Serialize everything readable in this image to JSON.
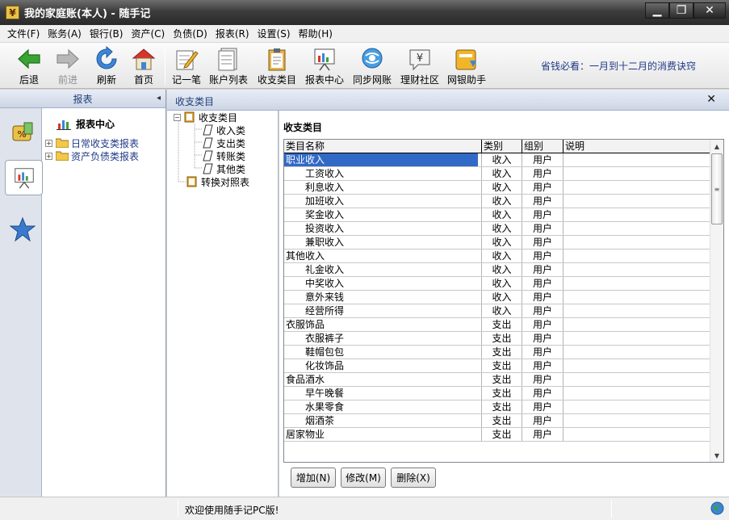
{
  "window": {
    "title": "我的家庭账(本人) - 随手记",
    "app_icon_glyph": "¥",
    "minimize": "▁",
    "maximize": "❐",
    "close": "✕"
  },
  "menu": [
    "文件(F)",
    "账务(A)",
    "银行(B)",
    "资产(C)",
    "负债(D)",
    "报表(R)",
    "设置(S)",
    "帮助(H)"
  ],
  "toolbar": {
    "back": "后退",
    "forward": "前进",
    "refresh": "刷新",
    "home": "首页",
    "record": "记一笔",
    "accounts": "账户列表",
    "categories": "收支类目",
    "reports": "报表中心",
    "sync": "同步网账",
    "community": "理财社区",
    "ebank": "网银助手",
    "tip": "省钱必看：一月到十二月的消费诀窍"
  },
  "left_panel": {
    "header": "报表",
    "collapse": "◂",
    "tree_title": "报表中心",
    "items": [
      {
        "expander": "+",
        "label": "日常收支类报表"
      },
      {
        "expander": "+",
        "label": "资产负债类报表"
      }
    ]
  },
  "tab": {
    "title": "收支类目",
    "close": "✕"
  },
  "category_tree": {
    "root_expander": "−",
    "root": "收支类目",
    "children": [
      "收入类",
      "支出类",
      "转账类",
      "其他类"
    ],
    "mapping": "转换对照表"
  },
  "main": {
    "title": "收支类目",
    "columns": [
      "类目名称",
      "类别",
      "组别",
      "说明"
    ],
    "rows": [
      {
        "name": "职业收入",
        "type": "收入",
        "group": "用户",
        "note": "",
        "level": 0,
        "selected": true
      },
      {
        "name": "工资收入",
        "type": "收入",
        "group": "用户",
        "note": "",
        "level": 1
      },
      {
        "name": "利息收入",
        "type": "收入",
        "group": "用户",
        "note": "",
        "level": 1
      },
      {
        "name": "加班收入",
        "type": "收入",
        "group": "用户",
        "note": "",
        "level": 1
      },
      {
        "name": "奖金收入",
        "type": "收入",
        "group": "用户",
        "note": "",
        "level": 1
      },
      {
        "name": "投资收入",
        "type": "收入",
        "group": "用户",
        "note": "",
        "level": 1
      },
      {
        "name": "兼职收入",
        "type": "收入",
        "group": "用户",
        "note": "",
        "level": 1
      },
      {
        "name": "其他收入",
        "type": "收入",
        "group": "用户",
        "note": "",
        "level": 0
      },
      {
        "name": "礼金收入",
        "type": "收入",
        "group": "用户",
        "note": "",
        "level": 1
      },
      {
        "name": "中奖收入",
        "type": "收入",
        "group": "用户",
        "note": "",
        "level": 1
      },
      {
        "name": "意外来钱",
        "type": "收入",
        "group": "用户",
        "note": "",
        "level": 1
      },
      {
        "name": "经营所得",
        "type": "收入",
        "group": "用户",
        "note": "",
        "level": 1
      },
      {
        "name": "衣服饰品",
        "type": "支出",
        "group": "用户",
        "note": "",
        "level": 0
      },
      {
        "name": "衣服裤子",
        "type": "支出",
        "group": "用户",
        "note": "",
        "level": 1
      },
      {
        "name": "鞋帽包包",
        "type": "支出",
        "group": "用户",
        "note": "",
        "level": 1
      },
      {
        "name": "化妆饰品",
        "type": "支出",
        "group": "用户",
        "note": "",
        "level": 1
      },
      {
        "name": "食品酒水",
        "type": "支出",
        "group": "用户",
        "note": "",
        "level": 0
      },
      {
        "name": "早午晚餐",
        "type": "支出",
        "group": "用户",
        "note": "",
        "level": 1
      },
      {
        "name": "水果零食",
        "type": "支出",
        "group": "用户",
        "note": "",
        "level": 1
      },
      {
        "name": "烟酒茶",
        "type": "支出",
        "group": "用户",
        "note": "",
        "level": 1
      },
      {
        "name": "居家物业",
        "type": "支出",
        "group": "用户",
        "note": "",
        "level": 0
      }
    ],
    "scroll": {
      "up": "▲",
      "down": "▼",
      "grip": "≡"
    },
    "buttons": {
      "add": "增加(N)",
      "edit": "修改(M)",
      "delete": "删除(X)"
    }
  },
  "status": {
    "text": "欢迎使用随手记PC版!"
  },
  "colors": {
    "selection": "#3169c6",
    "link": "#1f3a87",
    "titlebar": "#3c3c3c"
  }
}
